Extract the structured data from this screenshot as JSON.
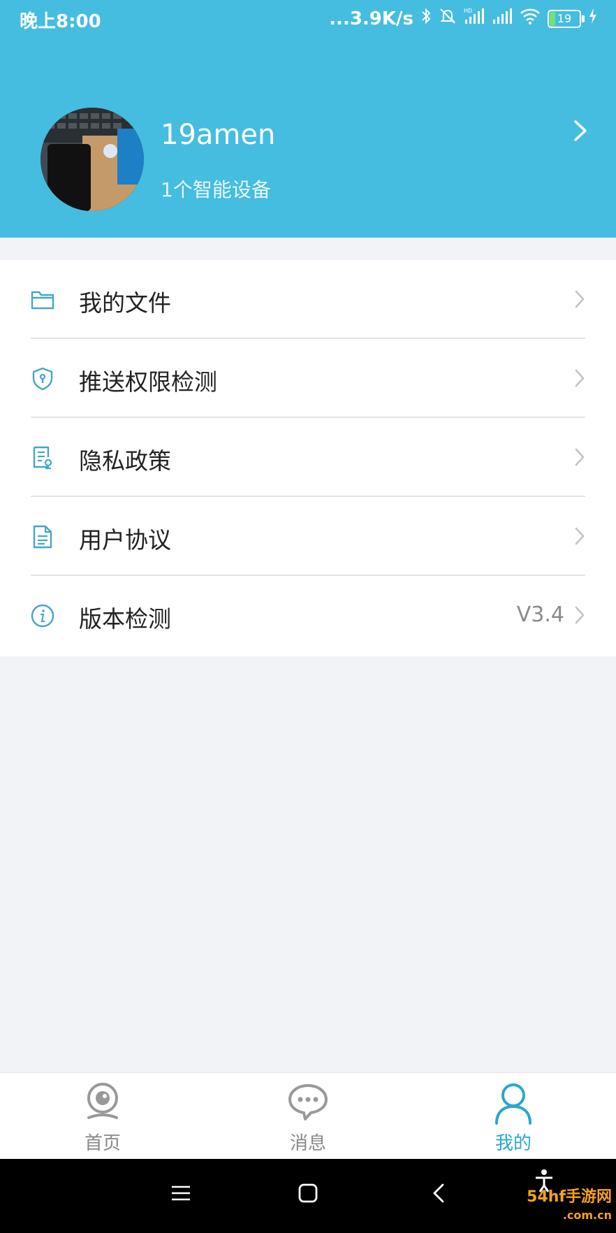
{
  "status_bar": {
    "time": "晚上8:00",
    "network_speed": "...3.9K/s",
    "battery_level": "19",
    "icons": [
      "bluetooth-icon",
      "mute-icon",
      "hd-signal-icon",
      "signal-icon",
      "wifi-icon",
      "battery-icon",
      "charging-icon"
    ]
  },
  "profile": {
    "username": "19amen",
    "device_count": "1个智能设备"
  },
  "menu": {
    "items": [
      {
        "label": "我的文件",
        "icon": "folder-icon"
      },
      {
        "label": "推送权限检测",
        "icon": "shield-icon"
      },
      {
        "label": "隐私政策",
        "icon": "privacy-doc-icon"
      },
      {
        "label": "用户协议",
        "icon": "document-icon"
      },
      {
        "label": "版本检测",
        "icon": "info-icon",
        "value": "V3.4"
      }
    ]
  },
  "tabs": [
    {
      "label": "首页",
      "icon": "camera-icon",
      "active": false
    },
    {
      "label": "消息",
      "icon": "chat-bubble-icon",
      "active": false
    },
    {
      "label": "我的",
      "icon": "person-icon",
      "active": true
    }
  ],
  "watermark": {
    "text": "54hf手游网",
    "subtext": ".com.cn"
  },
  "colors": {
    "header": "#45bde0",
    "accent": "#2aa7cf",
    "background": "#f2f3f7"
  }
}
